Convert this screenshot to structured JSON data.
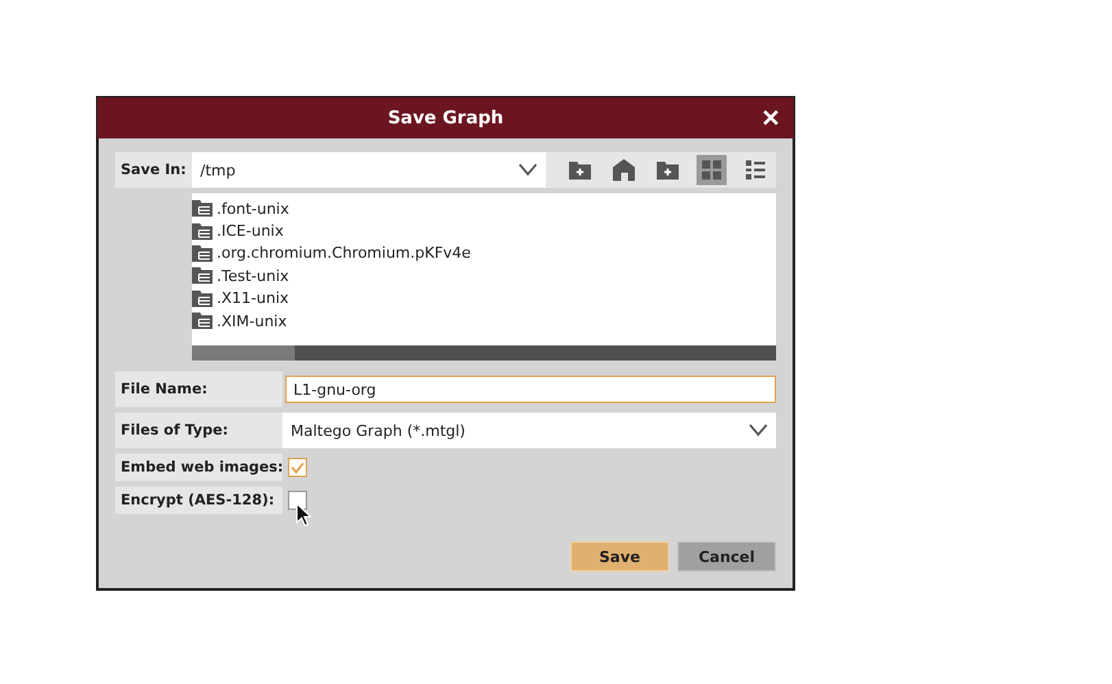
{
  "window": {
    "title": "Save Graph",
    "close": "✕"
  },
  "save_in": {
    "label": "Save In:",
    "value": "/tmp"
  },
  "view_buttons": [
    {
      "kind": "grid",
      "selected": true
    },
    {
      "kind": "list",
      "selected": false
    }
  ],
  "files": [
    {
      "name": ".font-unix"
    },
    {
      "name": ".ICE-unix"
    },
    {
      "name": ".org.chromium.Chromium.pKFv4e"
    },
    {
      "name": ".Test-unix"
    },
    {
      "name": ".X11-unix"
    },
    {
      "name": ".XIM-unix"
    }
  ],
  "file_name": {
    "label": "File Name:",
    "value": "L1-gnu-org"
  },
  "file_type": {
    "label": "Files of Type:",
    "value": "Maltego Graph (*.mtgl)"
  },
  "options": [
    {
      "label": "Embed web images:",
      "checked": true
    },
    {
      "label": "Encrypt (AES-128):",
      "checked": false
    }
  ],
  "buttons": [
    {
      "label": "Save",
      "kind": "primary"
    },
    {
      "label": "Cancel",
      "kind": "secondary"
    }
  ]
}
